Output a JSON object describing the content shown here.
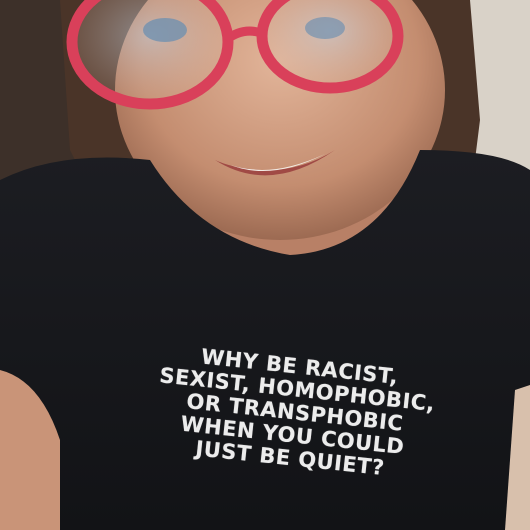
{
  "photo": {
    "shirt_text": [
      "WHY BE RACIST,",
      "SEXIST, HOMOPHOBIC,",
      "OR TRANSPHOBIC",
      "WHEN YOU COULD",
      "JUST BE QUIET?"
    ],
    "colors": {
      "shirt": "#17181c",
      "glasses_frame": "#d9405a",
      "skin": "#c99478",
      "hair": "#4a3428",
      "background_wall": "#8a7462",
      "print": "#ececec"
    }
  }
}
